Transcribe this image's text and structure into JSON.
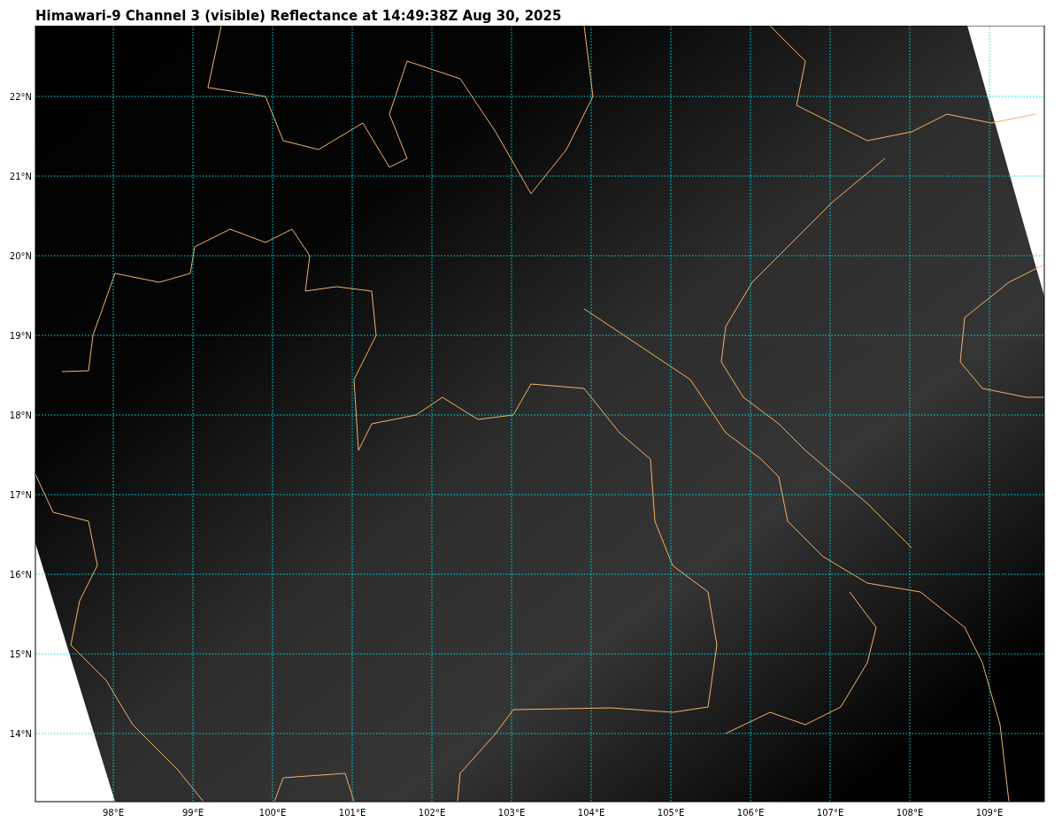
{
  "title": "Himawari-9 Channel 3 (visible) Reflectance at 14:49:38Z Aug 30, 2025",
  "map": {
    "lon_ticks": [
      "98°E",
      "99°E",
      "100°E",
      "101°E",
      "102°E",
      "103°E",
      "104°E",
      "105°E",
      "106°E",
      "107°E",
      "108°E",
      "109°E"
    ],
    "lat_ticks": [
      "22°N",
      "21°N",
      "20°N",
      "19°N",
      "18°N",
      "17°N",
      "16°N",
      "15°N",
      "14°N"
    ]
  }
}
